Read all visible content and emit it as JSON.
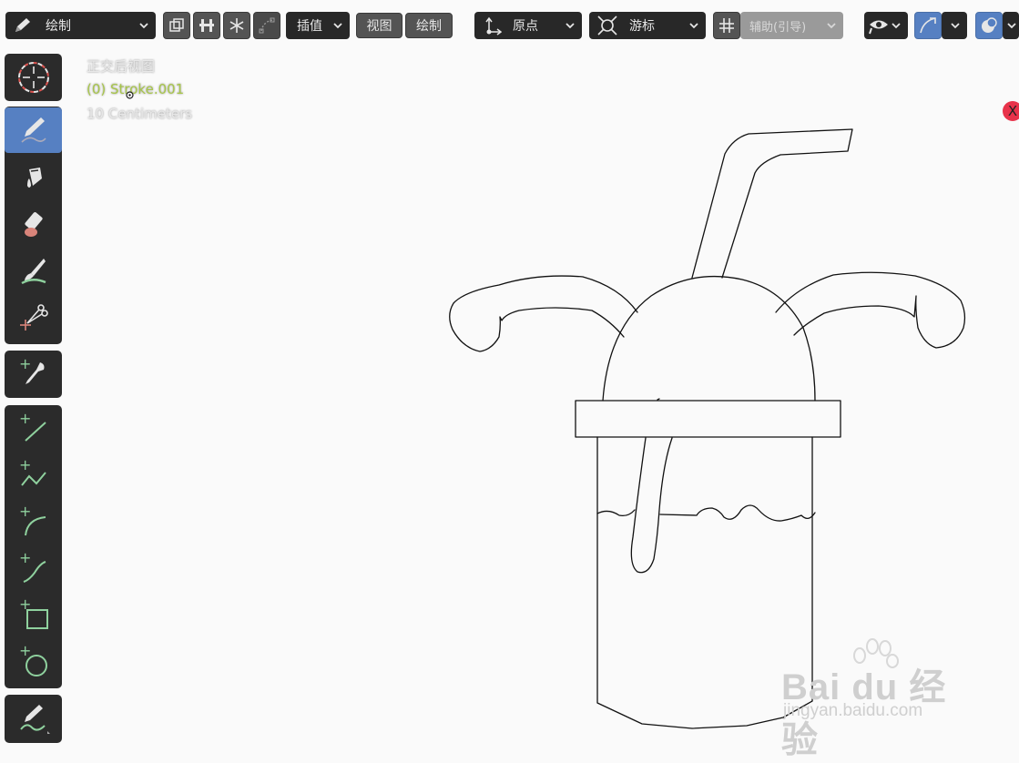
{
  "toolbar": {
    "mode_label": "绘制",
    "interp_label": "插值",
    "view_label": "视图",
    "draw_label": "绘制",
    "origin_label": "原点",
    "cursor_label": "游标",
    "guide_label": "辅助(引导)"
  },
  "viewport": {
    "view_name": "正交后视图",
    "object_name": "(0) Stroke.001",
    "scale_text": "10 Centimeters",
    "close_label": "X"
  },
  "watermark": {
    "brand": "Bai du 经验",
    "url": "jingyan.baidu.com"
  },
  "colors": {
    "accent": "#5680c2",
    "object_name": "#a8c64a",
    "stroke": "#111111"
  }
}
